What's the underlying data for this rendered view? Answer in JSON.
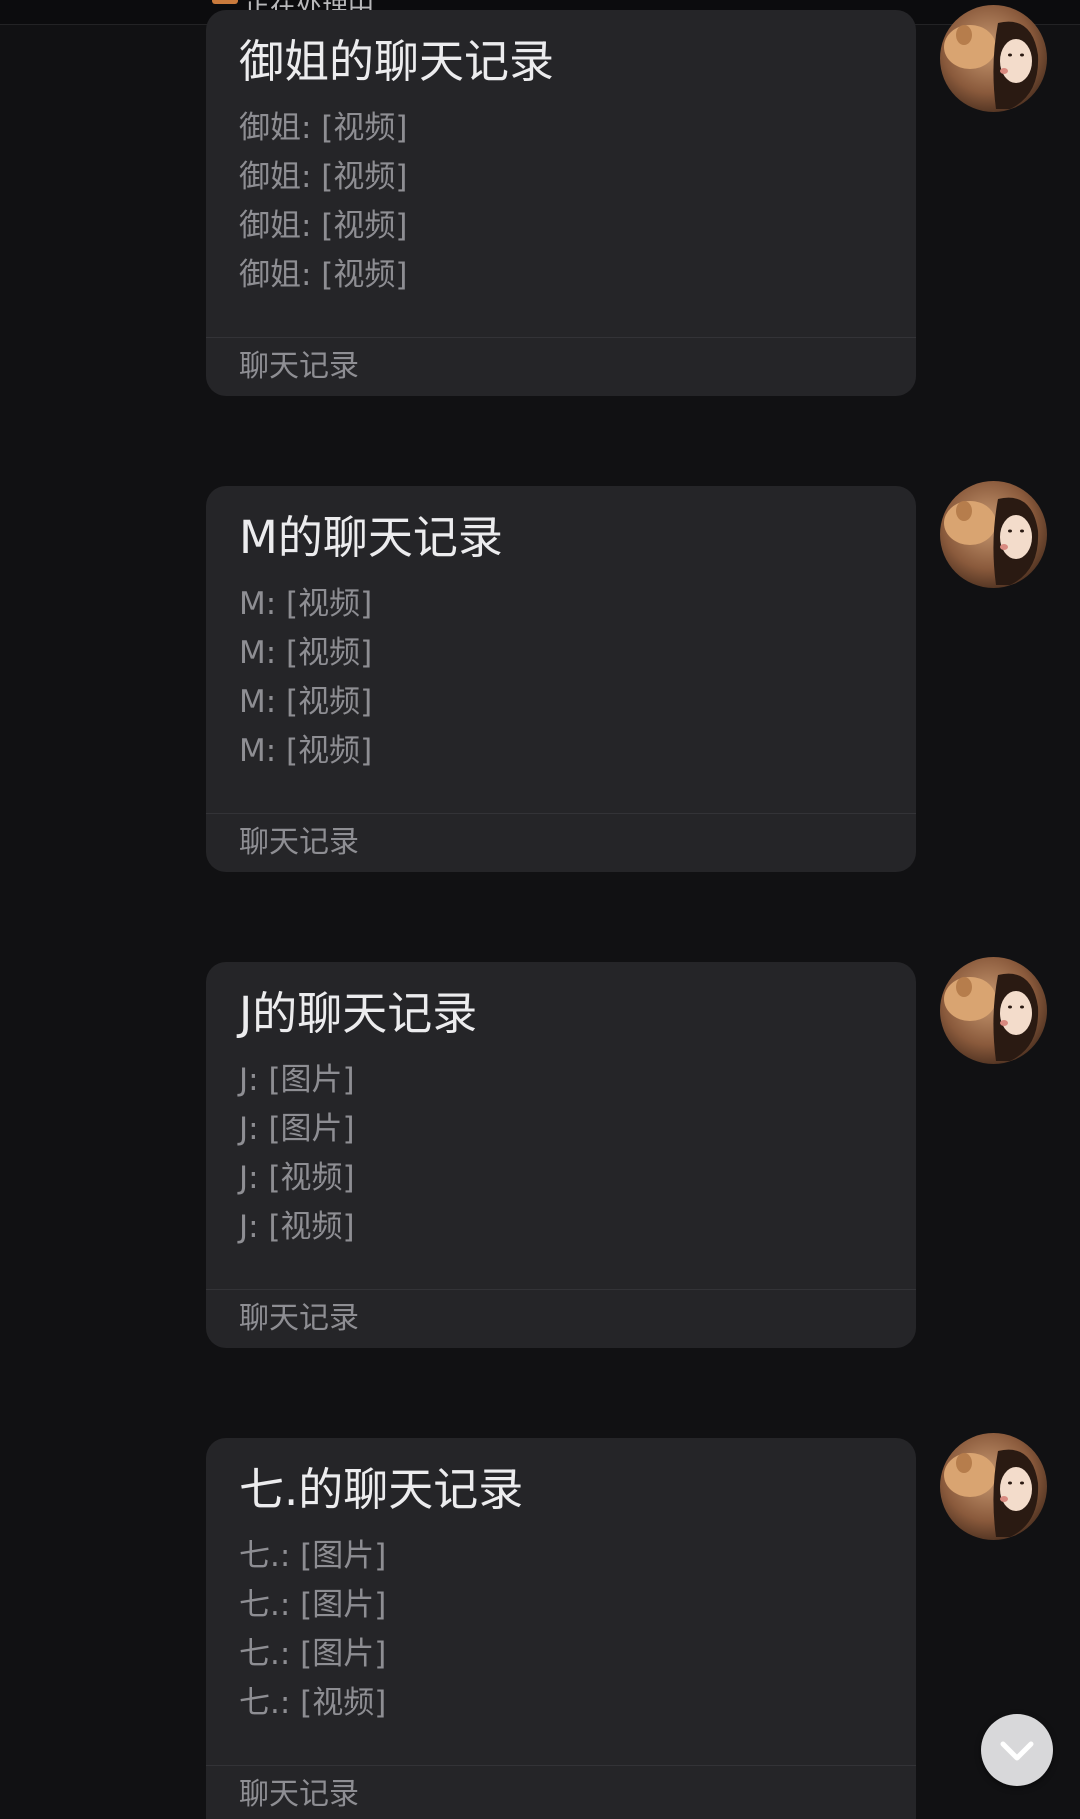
{
  "top_bar": {
    "text": "正在处理中..."
  },
  "cards": [
    {
      "title": "御姐的聊天记录",
      "lines": [
        "御姐: [视频]",
        "御姐: [视频]",
        "御姐: [视频]",
        "御姐: [视频]"
      ],
      "footer": "聊天记录"
    },
    {
      "title": "M的聊天记录",
      "lines": [
        "M: [视频]",
        "M: [视频]",
        "M: [视频]",
        "M: [视频]"
      ],
      "footer": "聊天记录"
    },
    {
      "title": "J的聊天记录",
      "lines": [
        "J: [图片]",
        "J: [图片]",
        "J: [视频]",
        "J: [视频]"
      ],
      "footer": "聊天记录"
    },
    {
      "title": "七.的聊天记录",
      "lines": [
        "七.: [图片]",
        "七.: [图片]",
        "七.: [图片]",
        "七.: [视频]"
      ],
      "footer": "聊天记录"
    }
  ],
  "icons": {
    "avatar": "user-avatar-girl-with-cat",
    "scroll_down": "chevron-down-icon"
  },
  "colors": {
    "background": "#111113",
    "bubble": "#252528",
    "title_text": "#ececee",
    "secondary_text": "#8e8e93"
  }
}
